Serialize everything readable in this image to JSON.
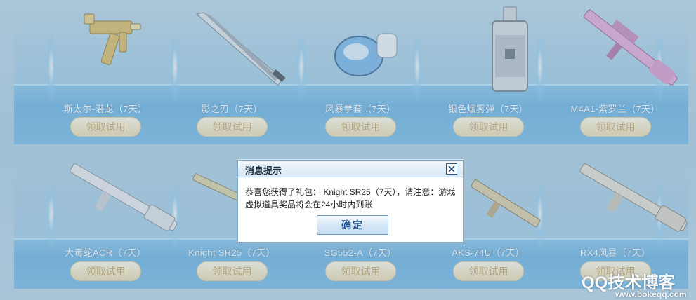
{
  "items_row1": [
    {
      "name": "斯太尔-潜龙（7天）",
      "claim_label": "领取试用",
      "icon": "smg-gold-icon"
    },
    {
      "name": "影之刃（7天）",
      "claim_label": "领取试用",
      "icon": "blade-icon"
    },
    {
      "name": "风暴拳套（7天）",
      "claim_label": "领取试用",
      "icon": "glove-icon"
    },
    {
      "name": "银色烟雾弹（7天）",
      "claim_label": "领取试用",
      "icon": "smoke-grenade-icon"
    },
    {
      "name": "M4A1-紫罗兰（7天）",
      "claim_label": "领取试用",
      "icon": "rifle-pink-icon"
    }
  ],
  "items_row2": [
    {
      "name": "大毒蛇ACR（7天）",
      "claim_label": "领取试用",
      "icon": "rifle-white-icon"
    },
    {
      "name": "Knight SR25（7天）",
      "claim_label": "领取试用",
      "icon": "sniper-icon"
    },
    {
      "name": "SG552-A（7天）",
      "claim_label": "领取试用",
      "icon": "rifle-icon"
    },
    {
      "name": "AKS-74U（7天）",
      "claim_label": "领取试用",
      "icon": "carbine-icon"
    },
    {
      "name": "RX4风暴（7天）",
      "claim_label": "领取试用",
      "icon": "rifle-silver-icon"
    }
  ],
  "dialog": {
    "title": "消息提示",
    "message": "恭喜您获得了礼包： Knight SR25（7天），请注意：游戏虚拟道具奖品将会在24小时内到账",
    "ok_label": "确定",
    "close_icon": "close-icon"
  },
  "watermark": {
    "text": "QQ技术博客",
    "url": "www.bokeqq.com"
  },
  "colors": {
    "background": "#b5d6ea",
    "shelf": "#6bb5e6",
    "claim_button": "#f6ebc6",
    "claim_text": "#c5a664",
    "dialog_accent": "#1e4f86"
  }
}
